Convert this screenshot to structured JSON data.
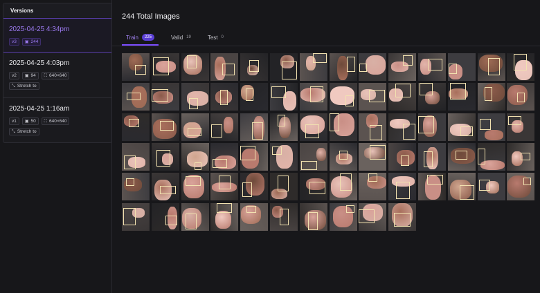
{
  "sidebar": {
    "header": "Versions",
    "versions": [
      {
        "date": "2025-04-25 4:34pm",
        "active": true,
        "tag_rows": [
          [
            {
              "icon": "",
              "label": "v3"
            },
            {
              "icon": "image-icon",
              "label": "244"
            }
          ]
        ]
      },
      {
        "date": "2025-04-25 4:03pm",
        "active": false,
        "tag_rows": [
          [
            {
              "icon": "",
              "label": "v2"
            },
            {
              "icon": "image-icon",
              "label": "94"
            },
            {
              "icon": "resize-icon",
              "label": "640×640"
            }
          ],
          [
            {
              "icon": "stretch-icon",
              "label": "Stretch to"
            }
          ]
        ]
      },
      {
        "date": "2025-04-25 1:16am",
        "active": false,
        "tag_rows": [
          [
            {
              "icon": "",
              "label": "v1"
            },
            {
              "icon": "image-icon",
              "label": "50"
            },
            {
              "icon": "resize-icon",
              "label": "640×640"
            }
          ],
          [
            {
              "icon": "stretch-icon",
              "label": "Stretch to"
            }
          ]
        ]
      }
    ]
  },
  "main": {
    "title": "244 Total Images",
    "tabs": [
      {
        "label": "Train",
        "count": "225",
        "active": true
      },
      {
        "label": "Valid",
        "count": "19",
        "active": false
      },
      {
        "label": "Test",
        "count": "0",
        "active": false
      }
    ]
  },
  "colors": {
    "accent": "#7c4dff",
    "accent_text": "#9d7bf2",
    "background": "#17171a"
  },
  "gallery": {
    "thumbnails_shown": 80
  }
}
